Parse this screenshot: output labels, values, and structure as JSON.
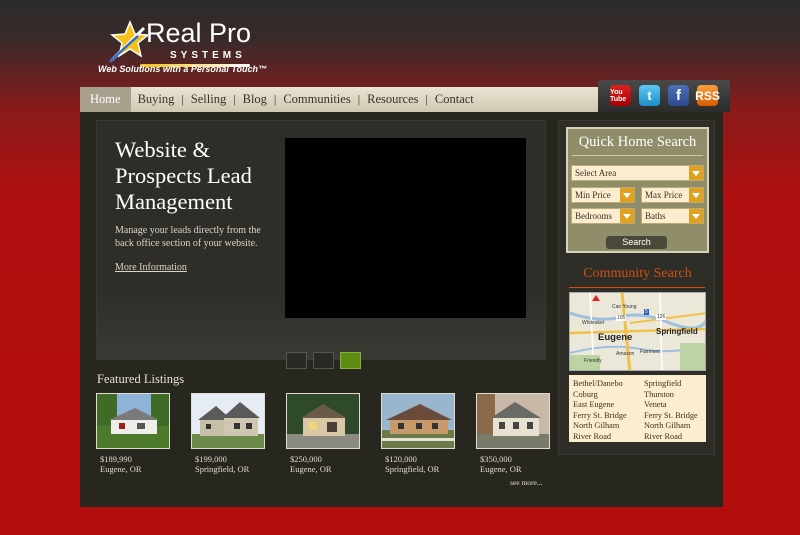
{
  "brand": {
    "name": "Real Pro",
    "sub": "SYSTEMS",
    "tagline": "Web Solutions with a Personal Touch™"
  },
  "nav": {
    "items": [
      "Home",
      "Buying",
      "Selling",
      "Blog",
      "Communities",
      "Resources",
      "Contact"
    ]
  },
  "social": {
    "youtube": "You Tube",
    "twitter": "t",
    "facebook": "f",
    "rss": "RSS"
  },
  "hero": {
    "title": "Website & Prospects Lead Management",
    "description": "Manage your leads directly from the back office section of your website.",
    "link": "More Information",
    "active_slide": 3
  },
  "featured": {
    "title": "Featured Listings",
    "see_more": "see more...",
    "listings": [
      {
        "price": "$189,990",
        "city": "Eugene, OR"
      },
      {
        "price": "$199,000",
        "city": "Springfield, OR"
      },
      {
        "price": "$250,000",
        "city": "Eugene, OR"
      },
      {
        "price": "$120,000",
        "city": "Springfield, OR"
      },
      {
        "price": "$350,000",
        "city": "Eugene, OR"
      }
    ]
  },
  "quick_search": {
    "title": "Quick Home Search",
    "area": "Select Area",
    "min_price": "Min Price",
    "max_price": "Max Price",
    "bedrooms": "Bedrooms",
    "baths": "Baths",
    "button": "Search"
  },
  "community_search": {
    "title": "Community Search",
    "map_labels": {
      "eugene": "Eugene",
      "springfield": "Springfield",
      "can_young": "Can Young",
      "whiteaker": "Whiteaker",
      "friendly": "Friendly",
      "amazon": "Amazon",
      "fairmont": "Fairmont",
      "hw105": "105",
      "hw5": "5",
      "hw126": "126"
    },
    "list": [
      "Bethel/Danebo",
      "Springfield",
      "Coburg",
      "Thurston",
      "East Eugene",
      "Veneta",
      "Ferry St. Bridge",
      "Ferry St. Bridge",
      "North Gilham",
      "North Gilham",
      "River Road",
      "River Road"
    ]
  }
}
